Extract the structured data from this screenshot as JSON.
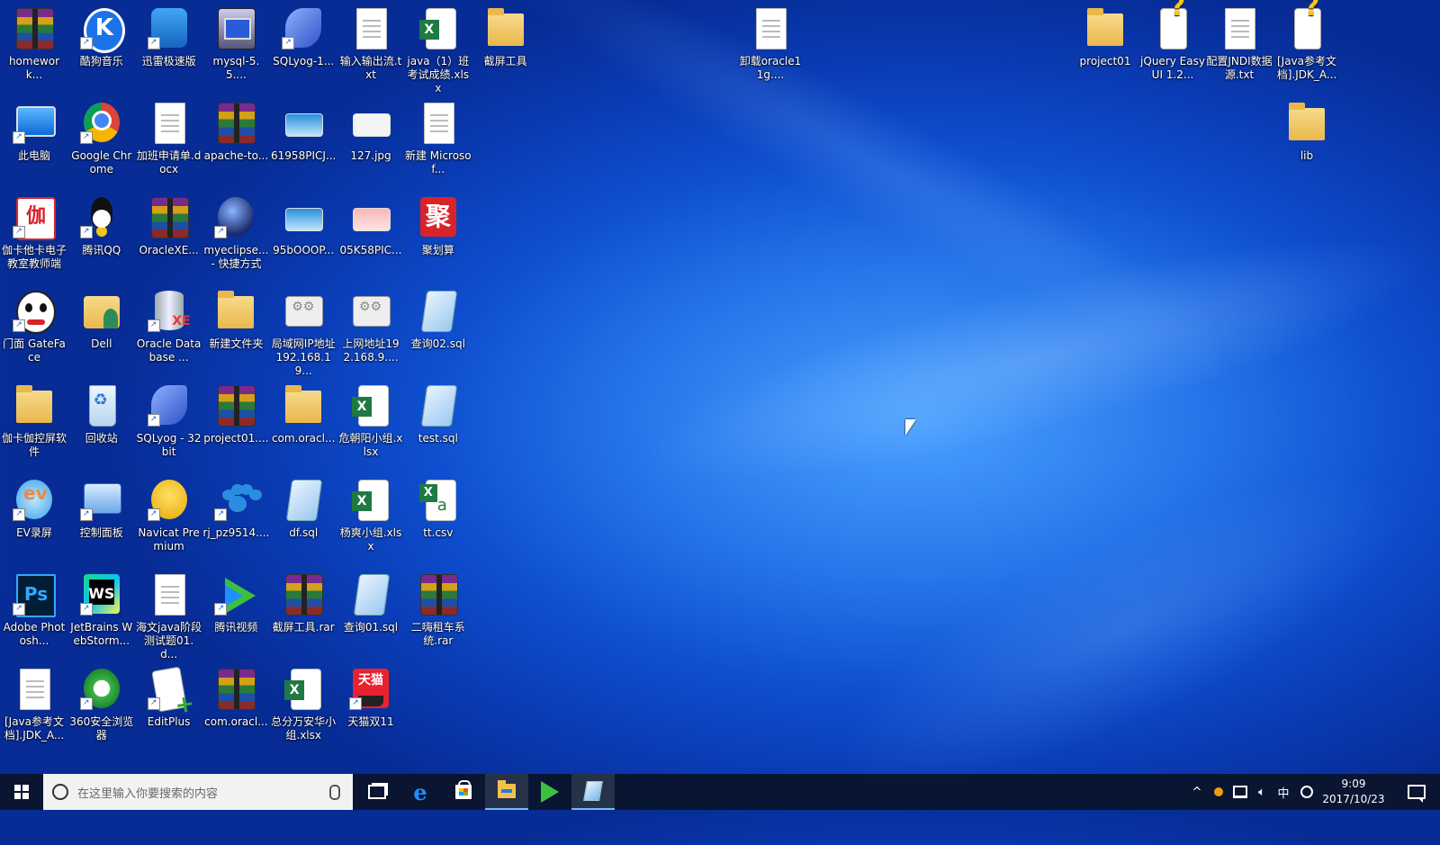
{
  "desktop": {
    "icons": [
      {
        "label": "homework...",
        "icon": "winrar-archive-icon",
        "col": 0,
        "row": 0
      },
      {
        "label": "酷狗音乐",
        "icon": "kugou-music-icon",
        "col": 1,
        "row": 0
      },
      {
        "label": "迅雷极速版",
        "icon": "xunlei-icon",
        "col": 2,
        "row": 0
      },
      {
        "label": "mysql-5.5....",
        "icon": "mysql-installer-icon",
        "col": 3,
        "row": 0
      },
      {
        "label": "SQLyog-1...",
        "icon": "sqlyog-icon",
        "col": 4,
        "row": 0
      },
      {
        "label": "输入输出流.txt",
        "icon": "text-file-icon",
        "col": 5,
        "row": 0
      },
      {
        "label": "java（1）班考试成绩.xlsx",
        "icon": "excel-file-icon",
        "col": 6,
        "row": 0
      },
      {
        "label": "截屏工具",
        "icon": "folder-icon",
        "col": 7,
        "row": 0
      },
      {
        "label": "此电脑",
        "icon": "this-pc-icon",
        "col": 0,
        "row": 1
      },
      {
        "label": "Google Chrome",
        "icon": "chrome-icon",
        "col": 1,
        "row": 1
      },
      {
        "label": "加班申请单.docx",
        "icon": "word-file-icon",
        "col": 2,
        "row": 1
      },
      {
        "label": "apache-to...",
        "icon": "winrar-archive-icon",
        "col": 3,
        "row": 1
      },
      {
        "label": "61958PICJ...",
        "icon": "image-file-icon",
        "col": 4,
        "row": 1
      },
      {
        "label": "127.jpg",
        "icon": "image-file-icon",
        "col": 5,
        "row": 1
      },
      {
        "label": "新建 Microsof...",
        "icon": "word-file-icon",
        "col": 6,
        "row": 1
      },
      {
        "label": "伽卡他卡电子教室教师端",
        "icon": "jiyuan-teacher-icon",
        "col": 0,
        "row": 2
      },
      {
        "label": "腾讯QQ",
        "icon": "qq-icon",
        "col": 1,
        "row": 2
      },
      {
        "label": "OracleXE...",
        "icon": "winrar-archive-icon",
        "col": 2,
        "row": 2
      },
      {
        "label": "myeclipse... - 快捷方式",
        "icon": "myeclipse-icon",
        "col": 3,
        "row": 2
      },
      {
        "label": "95bOOOP...",
        "icon": "image-file-icon",
        "col": 4,
        "row": 2
      },
      {
        "label": "05K58PIC...",
        "icon": "image-file-icon",
        "col": 5,
        "row": 2
      },
      {
        "label": "聚划算",
        "icon": "juhuasuan-icon",
        "col": 6,
        "row": 2
      },
      {
        "label": "门面 GateFace",
        "icon": "gateface-panda-icon",
        "col": 0,
        "row": 3
      },
      {
        "label": "Dell",
        "icon": "user-folder-icon",
        "col": 1,
        "row": 3
      },
      {
        "label": "Oracle Database ...",
        "icon": "oracle-database-icon",
        "col": 2,
        "row": 3
      },
      {
        "label": "新建文件夹",
        "icon": "folder-icon",
        "col": 3,
        "row": 3
      },
      {
        "label": "局域网IP地址192.168.19...",
        "icon": "network-shortcut-icon",
        "col": 4,
        "row": 3
      },
      {
        "label": "上网地址192.168.9....",
        "icon": "network-shortcut-icon",
        "col": 5,
        "row": 3
      },
      {
        "label": "查询02.sql",
        "icon": "sql-file-icon",
        "col": 6,
        "row": 3
      },
      {
        "label": "伽卡伽控屏软件",
        "icon": "folder-icon",
        "col": 0,
        "row": 4
      },
      {
        "label": "回收站",
        "icon": "recycle-bin-icon",
        "col": 1,
        "row": 4
      },
      {
        "label": "SQLyog - 32 bit",
        "icon": "sqlyog-icon",
        "col": 2,
        "row": 4
      },
      {
        "label": "project01....",
        "icon": "winrar-archive-icon",
        "col": 3,
        "row": 4
      },
      {
        "label": "com.oracl...",
        "icon": "folder-icon",
        "col": 4,
        "row": 4
      },
      {
        "label": "危朝阳小组.xlsx",
        "icon": "excel-file-icon",
        "col": 5,
        "row": 4
      },
      {
        "label": "test.sql",
        "icon": "sql-file-icon",
        "col": 6,
        "row": 4
      },
      {
        "label": "EV录屏",
        "icon": "ev-recorder-icon",
        "col": 0,
        "row": 5
      },
      {
        "label": "控制面板",
        "icon": "control-panel-icon",
        "col": 1,
        "row": 5
      },
      {
        "label": "Navicat Premium",
        "icon": "navicat-icon",
        "col": 2,
        "row": 5
      },
      {
        "label": "rj_pz9514....",
        "icon": "baidu-paw-icon",
        "col": 3,
        "row": 5
      },
      {
        "label": "df.sql",
        "icon": "sql-file-icon",
        "col": 4,
        "row": 5
      },
      {
        "label": "杨爽小组.xlsx",
        "icon": "excel-file-icon",
        "col": 5,
        "row": 5
      },
      {
        "label": "tt.csv",
        "icon": "csv-file-icon",
        "col": 6,
        "row": 5
      },
      {
        "label": "Adobe Photosh...",
        "icon": "photoshop-icon",
        "col": 0,
        "row": 6
      },
      {
        "label": "JetBrains WebStorm...",
        "icon": "webstorm-icon",
        "col": 1,
        "row": 6
      },
      {
        "label": "海文java阶段测试题01.d...",
        "icon": "word-file-icon",
        "col": 2,
        "row": 6
      },
      {
        "label": "腾讯视频",
        "icon": "tencent-video-icon",
        "col": 3,
        "row": 6
      },
      {
        "label": "截屏工具.rar",
        "icon": "winrar-archive-icon",
        "col": 4,
        "row": 6
      },
      {
        "label": "查询01.sql",
        "icon": "sql-file-icon",
        "col": 5,
        "row": 6
      },
      {
        "label": "二嗨租车系统.rar",
        "icon": "winrar-archive-icon",
        "col": 6,
        "row": 6
      },
      {
        "label": "[Java参考文档].JDK_A...",
        "icon": "blank-file-icon",
        "col": 0,
        "row": 7
      },
      {
        "label": "360安全浏览器",
        "icon": "360-browser-icon",
        "col": 1,
        "row": 7
      },
      {
        "label": "EditPlus",
        "icon": "editplus-icon",
        "col": 2,
        "row": 7
      },
      {
        "label": "com.oracl...",
        "icon": "winrar-archive-icon",
        "col": 3,
        "row": 7
      },
      {
        "label": "总分万安华小组.xlsx",
        "icon": "excel-file-icon",
        "col": 4,
        "row": 7
      },
      {
        "label": "天猫双11",
        "icon": "tmall-icon",
        "col": 5,
        "row": 7
      }
    ],
    "free_icons": [
      {
        "label": "卸载oracle11g....",
        "icon": "text-file-icon"
      },
      {
        "label": "project01",
        "icon": "folder-icon"
      },
      {
        "label": "jQuery EasyUI 1.2...",
        "icon": "help-file-icon"
      },
      {
        "label": "配置JNDI数据源.txt",
        "icon": "text-file-icon"
      },
      {
        "label": "[Java参考文档].JDK_A...",
        "icon": "help-file-icon"
      },
      {
        "label": "lib",
        "icon": "folder-icon"
      }
    ]
  },
  "taskbar": {
    "search_placeholder": "在这里输入你要搜索的内容",
    "pinned": [
      {
        "name": "task-view-icon"
      },
      {
        "name": "edge-icon"
      },
      {
        "name": "store-icon"
      },
      {
        "name": "file-explorer-icon"
      },
      {
        "name": "tencent-video-icon"
      },
      {
        "name": "notepad-icon"
      }
    ],
    "tray": {
      "ime": "中",
      "time": "9:09",
      "date": "2017/10/23"
    }
  },
  "colors": {
    "wallpaper_primary": "#2775ea",
    "taskbar_bg": "#0a1428",
    "taskbar_active_underline": "#76b9ed"
  }
}
